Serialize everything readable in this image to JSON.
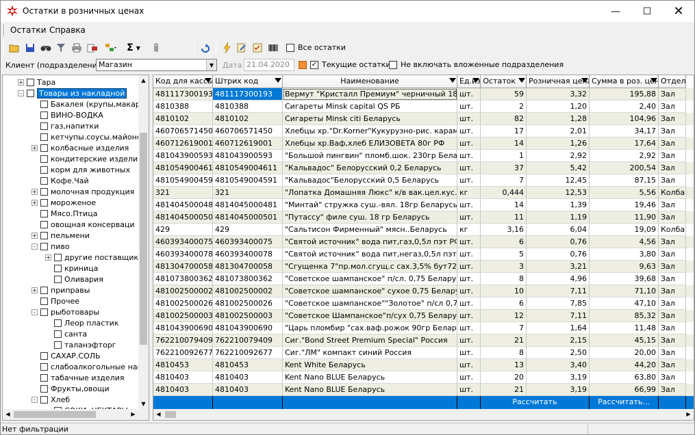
{
  "window": {
    "title": "Остатки в розничных ценах"
  },
  "menu": {
    "items": [
      "Остатки",
      "Справка"
    ]
  },
  "toolbar": {
    "all_stock_label": "Все остатки"
  },
  "filter": {
    "client_label": "Клиент (подразделение)",
    "client_value": "Магазин",
    "date_label": "Дата",
    "date_value": "21.04.2020",
    "current_stock_label": "Текущие остатки",
    "exclude_nested_label": "Не включать вложенные подразделения"
  },
  "tree": {
    "items": [
      {
        "label": "Тара",
        "level": 1,
        "exp": "+"
      },
      {
        "label": "Товары из накладной",
        "level": 1,
        "exp": "-",
        "selected": true
      },
      {
        "label": "Бакалея (крупы,макароны",
        "level": 2,
        "exp": ""
      },
      {
        "label": "ВИНО-ВОДКА",
        "level": 2,
        "exp": ""
      },
      {
        "label": "газ,напитки",
        "level": 2,
        "exp": ""
      },
      {
        "label": "кетчупы.соусы.майонез",
        "level": 2,
        "exp": ""
      },
      {
        "label": "колбасные изделия",
        "level": 2,
        "exp": "+"
      },
      {
        "label": "кондитерские изделия",
        "level": 2,
        "exp": ""
      },
      {
        "label": "корм для животных",
        "level": 2,
        "exp": ""
      },
      {
        "label": "Кофе.Чай",
        "level": 2,
        "exp": ""
      },
      {
        "label": "молочная продукция",
        "level": 2,
        "exp": "+"
      },
      {
        "label": "мороженое",
        "level": 2,
        "exp": "+"
      },
      {
        "label": "Мясо.Птица",
        "level": 2,
        "exp": ""
      },
      {
        "label": "овощная консерваци",
        "level": 2,
        "exp": ""
      },
      {
        "label": "пельмени",
        "level": 2,
        "exp": "+"
      },
      {
        "label": "пиво",
        "level": 2,
        "exp": "-"
      },
      {
        "label": "другие поставщики",
        "level": 3,
        "exp": "+"
      },
      {
        "label": "криница",
        "level": 3,
        "exp": ""
      },
      {
        "label": "Оливария",
        "level": 3,
        "exp": ""
      },
      {
        "label": "приправы",
        "level": 2,
        "exp": "+"
      },
      {
        "label": "Прочее",
        "level": 2,
        "exp": ""
      },
      {
        "label": "рыботовары",
        "level": 2,
        "exp": "-"
      },
      {
        "label": "Леор пластик",
        "level": 3,
        "exp": ""
      },
      {
        "label": "санта",
        "level": 3,
        "exp": ""
      },
      {
        "label": "таланэфторг",
        "level": 3,
        "exp": ""
      },
      {
        "label": "САХАР.СОЛЬ",
        "level": 2,
        "exp": ""
      },
      {
        "label": "слабоалкогольные напи",
        "level": 2,
        "exp": ""
      },
      {
        "label": "табачные изделия",
        "level": 2,
        "exp": ""
      },
      {
        "label": "Фрукты,овощи",
        "level": 2,
        "exp": ""
      },
      {
        "label": "Хлеб",
        "level": 2,
        "exp": "-"
      },
      {
        "label": "СОКИ, НЕКТАРЫ",
        "level": 3,
        "exp": ""
      }
    ]
  },
  "grid": {
    "columns": [
      "Код для кассы",
      "Штрих код",
      "Наименование",
      "Ед.изм",
      "Остаток",
      "Розничная цена",
      "Сумма в роз. ценах",
      "Отдел"
    ],
    "rows": [
      [
        "481117300193",
        "481117300193",
        "Вермут \"Кристалл Премиум\" черничный 18% 0,5",
        "шт.",
        "59",
        "3,32",
        "195,88",
        "Зал"
      ],
      [
        "4810388",
        "4810388",
        "Сигареты  Minsk capital QS РБ",
        "шт.",
        "2",
        "1,20",
        "2,40",
        "Зал"
      ],
      [
        "4810102",
        "4810102",
        "Сигареты  Minsk citi  Беларусь",
        "шт.",
        "82",
        "1,28",
        "104,96",
        "Зал"
      ],
      [
        "460706571450",
        "460706571450",
        "Хлебцы хр.\"Dr.Korner\"Кукурузно-рис. карам.\"90г",
        "шт.",
        "17",
        "2,01",
        "34,17",
        "Зал"
      ],
      [
        "460712619001",
        "460712619001",
        "Хлебцы хр.Ваф,хлеб ЕЛИЗОВЕТА  80г РФ",
        "шт.",
        "14",
        "1,26",
        "17,64",
        "Зал"
      ],
      [
        "481043900593",
        "481043900593",
        "\"Большой пингвин\" пломб.шок. 230гр Беларусь",
        "шт.",
        "1",
        "2,92",
        "2,92",
        "Зал"
      ],
      [
        "4810549004611",
        "4810549004611",
        "\"Кальвадос\" Белорусский 0,2 Беларусь",
        "шт.",
        "37",
        "5,42",
        "200,54",
        "Зал"
      ],
      [
        "4810549004591",
        "4810549004591",
        "\"Кальвадос\"Белорусский 0,5 Беларусь",
        "шт.",
        "7",
        "12,45",
        "87,15",
        "Зал"
      ],
      [
        "321",
        "321",
        "\"Лопатка Домашняя Люкс\" к/в вак.цел.кус.Белар",
        "кг",
        "0,444",
        "12,53",
        "5,56",
        "Колба"
      ],
      [
        "4814045000481",
        "4814045000481",
        "\"Минтай\" стружка  суш.-вял. 18гр Беларусь",
        "шт.",
        "14",
        "1,39",
        "19,46",
        "Зал"
      ],
      [
        "4814045000501",
        "4814045000501",
        "\"Путассу\" филе суш. 18 гр  Беларусь",
        "шт.",
        "11",
        "1,19",
        "11,90",
        "Зал"
      ],
      [
        "429",
        "429",
        "\"Сальтисон Фирменный\" мясн..Беларусь",
        "кг",
        "3,16",
        "6,04",
        "19,09",
        "Колба"
      ],
      [
        "460393400075",
        "460393400075",
        "\"Святой источник\" вода пит,газ,0,5л пэт РФ",
        "шт.",
        "6",
        "0,76",
        "4,56",
        "Зал"
      ],
      [
        "460393400078",
        "460393400078",
        "\"Святой источник\" вода пит,негаз,0,5л пэт РФ",
        "шт.",
        "5",
        "0,76",
        "3,80",
        "Зал"
      ],
      [
        "481304700058",
        "481304700058",
        "\"Сгущенка 7\"пр.мол.сгущ.с сах.3,5% бут720г РБ",
        "шт.",
        "3",
        "3,21",
        "9,63",
        "Зал"
      ],
      [
        "481073800362",
        "481073800362",
        "\"Советское шампанское\" п/сл. 0,75 Беларусь",
        "шт.",
        "8",
        "4,96",
        "39,68",
        "Зал"
      ],
      [
        "481002500002",
        "481002500002",
        "\"Советское шампанское\" сухое 0,75 Беларусь",
        "шт.",
        "10",
        "7,11",
        "71,10",
        "Зал"
      ],
      [
        "481002500026",
        "481002500026",
        "\"Советское шампанское\"\"Золотое\" п/сл 0,75 Бела",
        "шт.",
        "6",
        "7,85",
        "47,10",
        "Зал"
      ],
      [
        "481002500003",
        "481002500003",
        "\"Советское Шампанское\"п/сух 0,75 Беларусь",
        "шт.",
        "12",
        "7,11",
        "85,32",
        "Зал"
      ],
      [
        "481043900690",
        "481043900690",
        "\"Царь пломбир \"сах.ваф.рожок 90гр Беларусь",
        "шт.",
        "7",
        "1,64",
        "11,48",
        "Зал"
      ],
      [
        "762210079409",
        "762210079409",
        "Сиг.\"Bond Street Premium Special\" Россия",
        "шт.",
        "21",
        "2,15",
        "45,15",
        "Зал"
      ],
      [
        "762210092677",
        "762210092677",
        "Сиг.\"ЛМ\" компакт синий Россия",
        "шт.",
        "8",
        "2,50",
        "20,00",
        "Зал"
      ],
      [
        "4810453",
        "4810453",
        "Kent  White  Беларусь",
        "шт.",
        "13",
        "3,40",
        "44,20",
        "Зал"
      ],
      [
        "4810403",
        "4810403",
        "Kent Nano BLUE  Беларусь",
        "шт.",
        "20",
        "3,19",
        "63,80",
        "Зал"
      ],
      [
        "4810403",
        "4810403",
        "Kent Nano BLUE  Беларусь",
        "шт.",
        "21",
        "3,19",
        "66,99",
        "Зал"
      ]
    ],
    "footer": {
      "calc1": "Рассчитать",
      "calc2": "Рассчитать..."
    }
  },
  "status": {
    "text": "Нет фильтрации"
  }
}
